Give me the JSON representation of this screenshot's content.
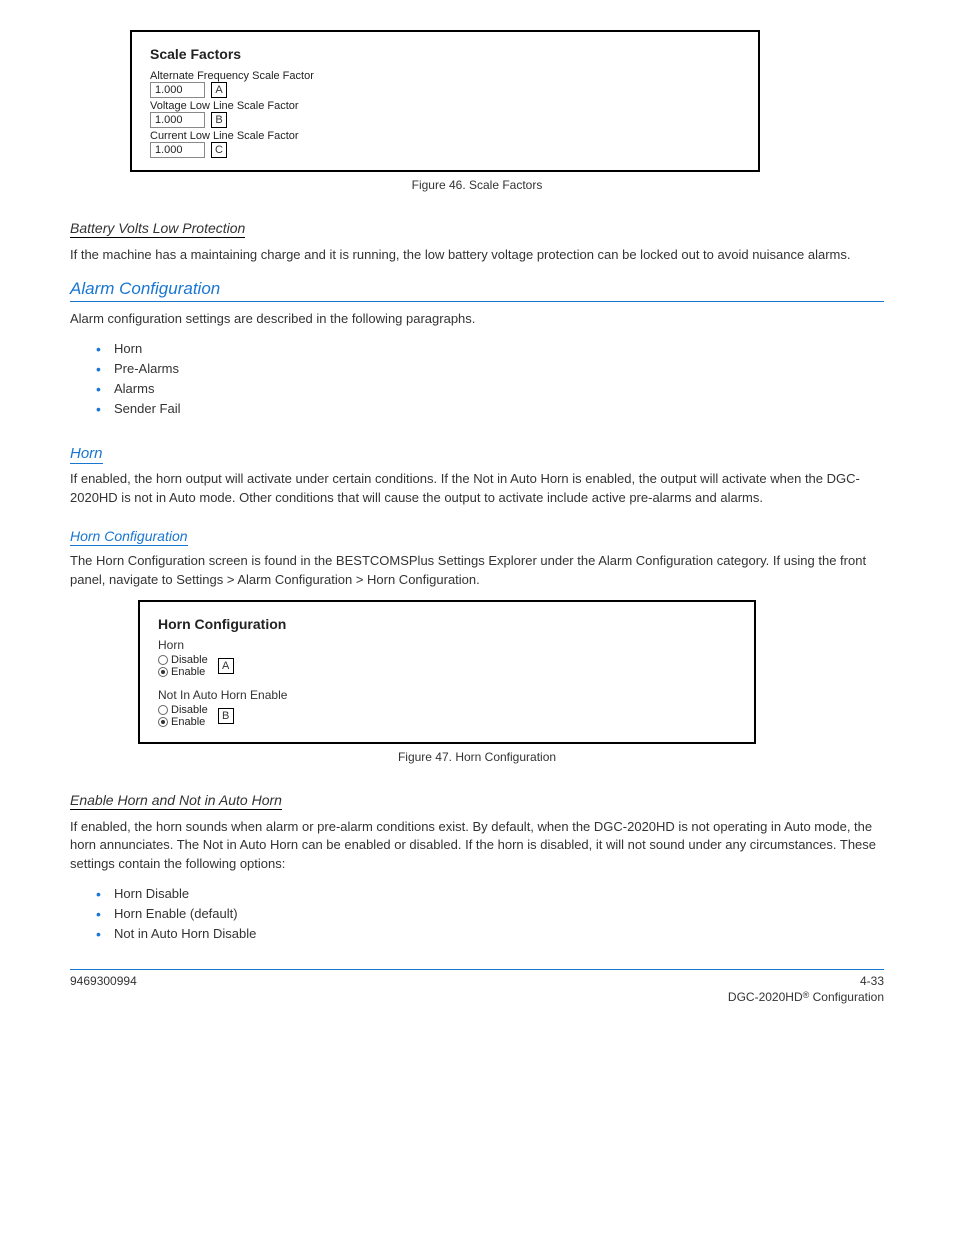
{
  "scale_factors": {
    "title": "Scale Factors",
    "rows": [
      {
        "label": "Alternate Frequency Scale Factor",
        "value": "1.000",
        "letter": "A"
      },
      {
        "label": "Voltage Low Line Scale Factor",
        "value": "1.000",
        "letter": "B"
      },
      {
        "label": "Current Low Line Scale Factor",
        "value": "1.000",
        "letter": "C"
      }
    ],
    "caption": "Figure 46. Scale Factors"
  },
  "protection_lockout": {
    "heading": "Battery Volts Low Protection",
    "text": "If the machine has a maintaining charge and it is running, the low battery voltage protection can be locked out to avoid nuisance alarms."
  },
  "alarm_config": {
    "heading": "Alarm Configuration",
    "intro": "Alarm configuration settings are described in the following paragraphs.",
    "bullets": [
      "Horn",
      "Pre-Alarms",
      "Alarms",
      "Sender Fail"
    ]
  },
  "horn_section": {
    "link_heading": "Horn",
    "text": "If enabled, the horn output will activate under certain conditions. If the Not in Auto Horn is enabled, the output will activate when the DGC-2020HD is not in Auto mode. Other conditions that will cause the output to activate include active pre-alarms and alarms.",
    "link_sub": "Horn Configuration",
    "screen_text": "The Horn Configuration screen is found in the BESTCOMSPlus Settings Explorer under the Alarm Configuration category. If using the front panel, navigate to Settings > Alarm Configuration > Horn Configuration.",
    "box": {
      "title": "Horn Configuration",
      "horn_label": "Horn",
      "not_in_auto_label": "Not In Auto Horn Enable",
      "disable": "Disable",
      "enable": "Enable",
      "letter_a": "A",
      "letter_b": "B",
      "caption": "Figure 47. Horn Configuration"
    },
    "enable_heading": "Enable Horn and Not in Auto Horn",
    "enable_text": "If enabled, the horn sounds when alarm or pre-alarm conditions exist. By default, when the DGC-2020HD is not operating in Auto mode, the horn annunciates. The Not in Auto Horn can be enabled or disabled. If the horn is disabled, it will not sound under any circumstances. These settings contain the following options:",
    "enable_bullets": [
      "Horn Disable",
      "Horn Enable (default)",
      "Not in Auto Horn Disable"
    ]
  },
  "footer": {
    "left": "9469300994",
    "page": "4-33",
    "right_prefix": "DGC-2020HD",
    "right_suffix": "Configuration",
    "reg": "®"
  }
}
